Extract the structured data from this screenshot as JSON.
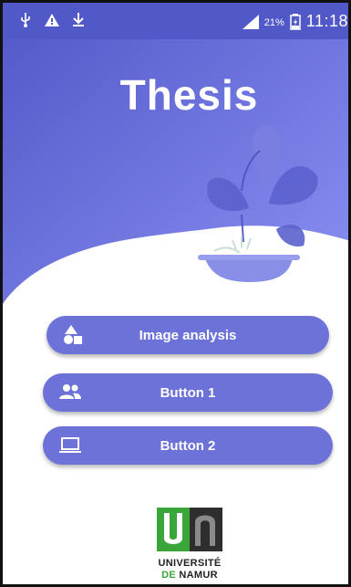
{
  "status_bar": {
    "battery_percent": "21%",
    "time": "11:18",
    "icons": [
      "usb-icon",
      "warning-icon",
      "download-icon",
      "signal-icon",
      "battery-icon"
    ]
  },
  "header": {
    "title": "Thesis"
  },
  "buttons": [
    {
      "label": "Image analysis",
      "icon": "shapes-icon"
    },
    {
      "label": "Button 1",
      "icon": "group-icon"
    },
    {
      "label": "Button 2",
      "icon": "laptop-icon"
    }
  ],
  "logo": {
    "line1": "UNIVERSITÉ",
    "line2_a": "DE",
    "line2_b": "NAMUR"
  },
  "colors": {
    "hero_top": "#5158c8",
    "hero_bottom": "#7d85ef",
    "button": "#6d72d8",
    "logo_green": "#3aa63a",
    "logo_dark": "#2e2e2e"
  }
}
